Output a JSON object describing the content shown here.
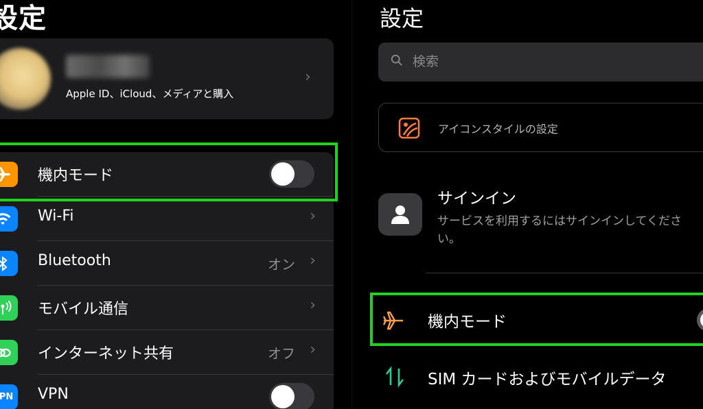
{
  "left": {
    "title": "設定",
    "profile": {
      "name": "████ ██",
      "subtitle": "Apple ID、iCloud、メディアと購入"
    },
    "rows": [
      {
        "label": "機内モード",
        "icon": "airplane-icon",
        "icon_color": "#ff9500",
        "type": "toggle",
        "toggle_on": false
      },
      {
        "label": "Wi-Fi",
        "icon": "wifi-icon",
        "icon_color": "#0a84ff",
        "type": "chevron",
        "value": ""
      },
      {
        "label": "Bluetooth",
        "icon": "bluetooth-icon",
        "icon_color": "#0a84ff",
        "type": "chevron",
        "value": "オン"
      },
      {
        "label": "モバイル通信",
        "icon": "antenna-icon",
        "icon_color": "#30d158",
        "type": "chevron",
        "value": ""
      },
      {
        "label": "インターネット共有",
        "icon": "link-icon",
        "icon_color": "#30d158",
        "type": "chevron",
        "value": "オフ"
      },
      {
        "label": "VPN",
        "icon": "vpn-icon",
        "icon_color": "#0a84ff",
        "icon_text": "VPN",
        "type": "toggle",
        "toggle_on": false
      }
    ]
  },
  "right": {
    "title": "設定",
    "search": {
      "placeholder": "検索"
    },
    "icon_style": {
      "label": "アイコンスタイルの設定",
      "icon": "palette-icon",
      "icon_color": "#ff7a3d"
    },
    "signin": {
      "title": "サインイン",
      "description": "サービスを利用するにはサインインしてください。"
    },
    "airplane_mode": {
      "label": "機内モード",
      "icon": "airplane-icon",
      "icon_color": "#ff9f43",
      "toggle_on": false
    },
    "sim": {
      "label": "SIM カードおよびモバイルデータ",
      "icon": "sim-transfer-icon",
      "icon_color": "#2ecc9a"
    }
  },
  "highlight_color": "#22d11e"
}
